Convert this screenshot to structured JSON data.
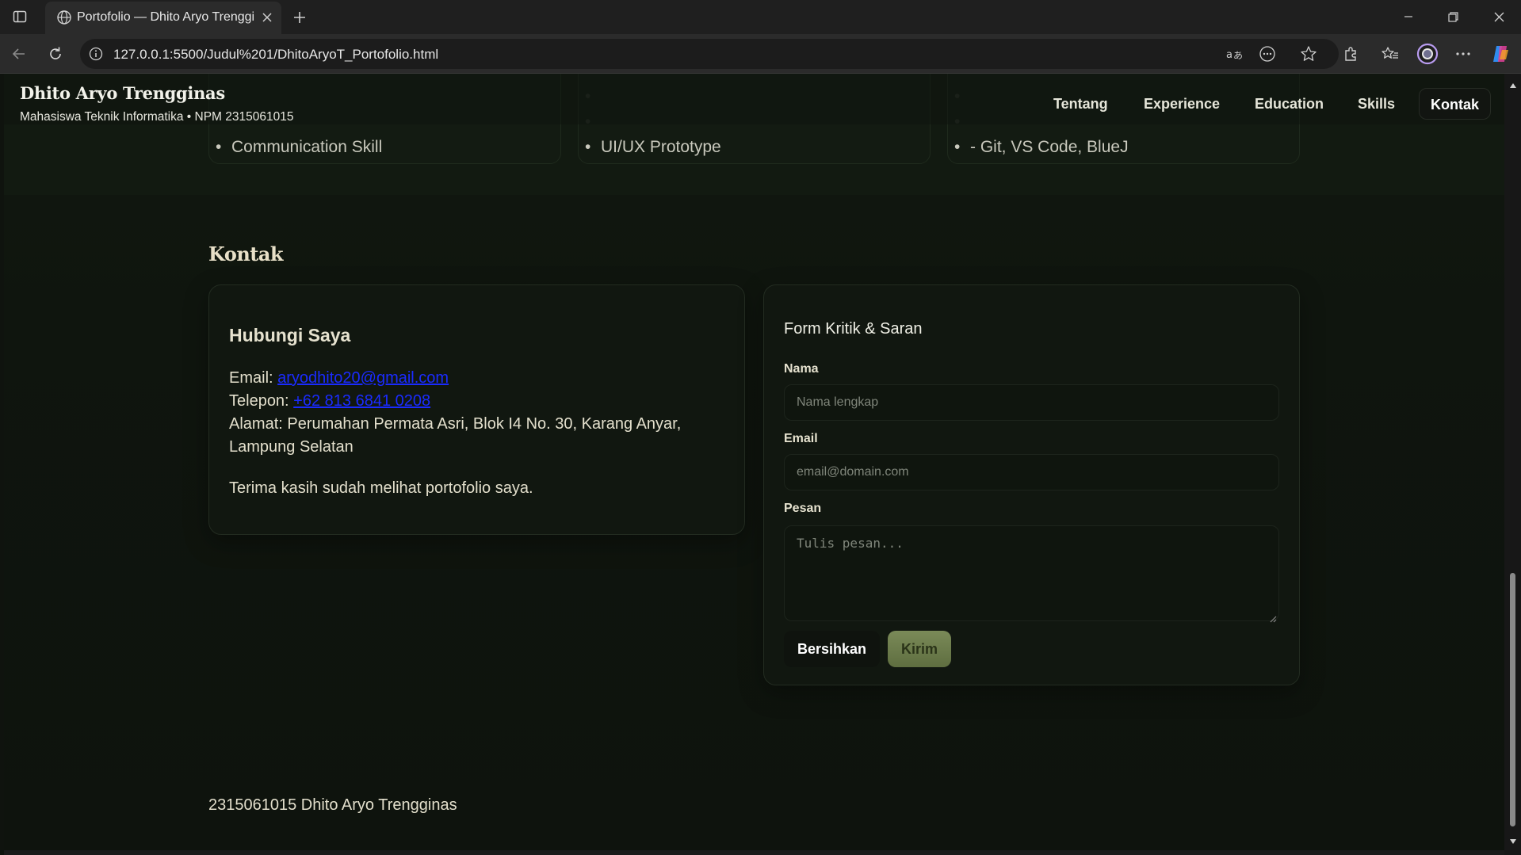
{
  "browser": {
    "tab_title": "Portofolio — Dhito Aryo Trenggin",
    "url": "127.0.0.1:5500/Judul%201/DhitoAryoT_Portofolio.html"
  },
  "header": {
    "name": "Dhito Aryo Trengginas",
    "subtitle": "Mahasiswa Teknik Informatika • NPM 2315061015",
    "nav": [
      {
        "label": "Tentang"
      },
      {
        "label": "Experience"
      },
      {
        "label": "Education"
      },
      {
        "label": "Skills"
      },
      {
        "label": "Kontak"
      }
    ],
    "active_nav": "Kontak"
  },
  "skills_remnant": {
    "col1": [
      "Communication Skill"
    ],
    "col2": [
      "UI/UX Prototype"
    ],
    "col3": [
      "- Git, VS Code, BlueJ"
    ]
  },
  "kontak": {
    "title": "Kontak",
    "contact": {
      "heading": "Hubungi Saya",
      "email_label": "Email: ",
      "email": "aryodhito20@gmail.com",
      "phone_label": "Telepon: ",
      "phone": "+62 813 6841 0208",
      "address_line1": "Alamat: Perumahan Permata Asri, Blok I4 No. 30, Karang Anyar,",
      "address_line2": "Lampung Selatan",
      "thanks": "Terima kasih sudah melihat portofolio saya."
    },
    "form": {
      "heading": "Form Kritik & Saran",
      "name_label": "Nama",
      "name_placeholder": "Nama lengkap",
      "email_label": "Email",
      "email_placeholder": "email@domain.com",
      "message_label": "Pesan",
      "message_placeholder": "Tulis pesan...",
      "clear_label": "Bersihkan",
      "send_label": "Kirim"
    }
  },
  "footer": {
    "text": "2315061015 Dhito Aryo Trengginas"
  },
  "colors": {
    "page_bg": "#0f130e",
    "accent": "#6f7f4c",
    "link": "#1a2bff",
    "heading": "#e8e0c8"
  }
}
